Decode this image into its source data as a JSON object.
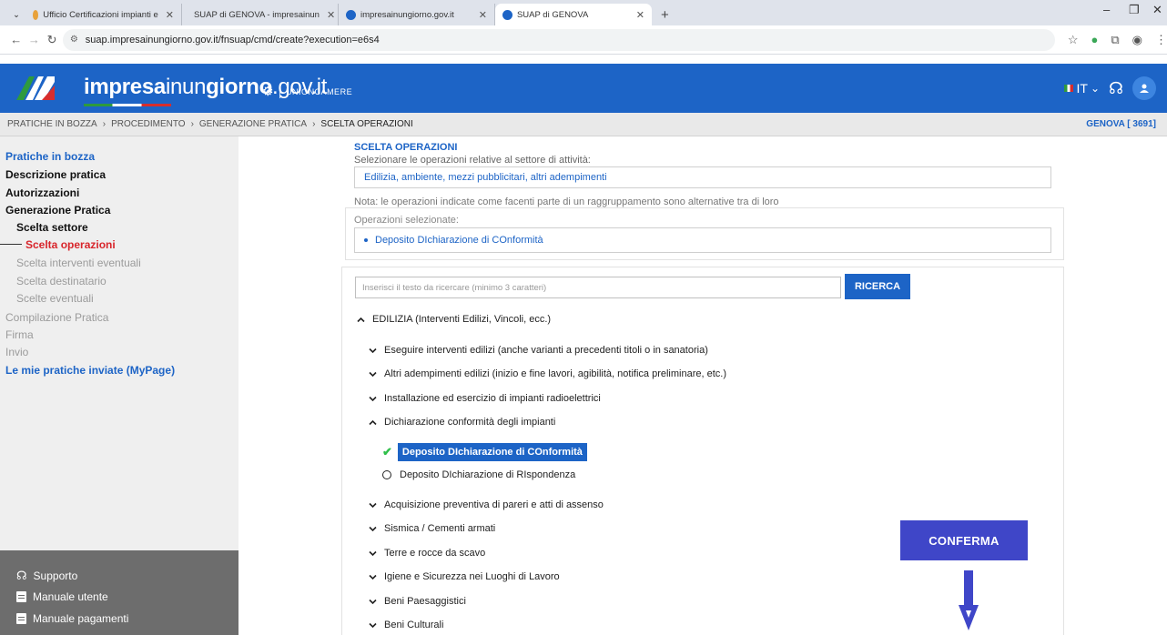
{
  "browser": {
    "tabs": [
      {
        "title": "Ufficio Certificazioni impianti e",
        "active": false
      },
      {
        "title": "SUAP di GENOVA - impresainun",
        "active": false
      },
      {
        "title": "impresainungiorno.gov.it",
        "active": false
      },
      {
        "title": "SUAP di GENOVA",
        "active": true
      }
    ],
    "url": "suap.impresainungiorno.gov.it/fnsuap/cmd/create?execution=e6s4"
  },
  "header": {
    "logo_bold": "impresa",
    "logo_mid": "inun",
    "logo_bold2": "giorno",
    "logo_suffix": ".gov.it",
    "partner": "UNIONCAMERE",
    "language": "IT",
    "brand_color": "#1d64c6"
  },
  "breadcrumb": {
    "items": [
      "PRATICHE IN BOZZA",
      "PROCEDIMENTO",
      "GENERAZIONE PRATICA",
      "SCELTA OPERAZIONI"
    ],
    "location": "GENOVA [ 3691]"
  },
  "sidebar": {
    "items": [
      {
        "label": "Pratiche in bozza",
        "style": "link"
      },
      {
        "label": "Descrizione pratica",
        "style": "black"
      },
      {
        "label": "Autorizzazioni",
        "style": "black"
      },
      {
        "label": "Generazione Pratica",
        "style": "black"
      },
      {
        "label": "Scelta settore",
        "style": "black"
      },
      {
        "label": "Scelta operazioni",
        "style": "current"
      },
      {
        "label": "Scelta interventi eventuali",
        "style": "disabled"
      },
      {
        "label": "Scelta destinatario",
        "style": "disabled"
      },
      {
        "label": "Scelte eventuali",
        "style": "disabled"
      },
      {
        "label": "Compilazione Pratica",
        "style": "disabled"
      },
      {
        "label": "Firma",
        "style": "disabled"
      },
      {
        "label": "Invio",
        "style": "disabled"
      },
      {
        "label": "Le mie pratiche inviate (MyPage)",
        "style": "link"
      }
    ],
    "bottom": [
      {
        "label": "Supporto",
        "icon": "support-icon"
      },
      {
        "label": "Manuale utente",
        "icon": "manual-icon"
      },
      {
        "label": "Manuale pagamenti",
        "icon": "manual-icon"
      }
    ]
  },
  "main": {
    "title": "SCELTA OPERAZIONI",
    "subtitle": "Selezionare le operazioni relative al settore di attività:",
    "sector": "Edilizia, ambiente, mezzi pubblicitari, altri adempimenti",
    "note": "Nota: le operazioni indicate come facenti parte di un raggruppamento sono alternative tra di loro",
    "selected_label": "Operazioni selezionate:",
    "selected_items": [
      "Deposito DIchiarazione di COnformità"
    ],
    "search_placeholder": "Inserisci il testo da ricercare (minimo 3 caratteri)",
    "search_button": "RICERCA",
    "category": "EDILIZIA (Interventi Edilizi, Vincoli, ecc.)",
    "groups": [
      "Eseguire interventi edilizi (anche varianti a precedenti titoli o in sanatoria)",
      "Altri adempimenti edilizi (inizio e fine lavori, agibilità, notifica preliminare, etc.)",
      "Installazione ed esercizio di impianti radioelettrici",
      "Dichiarazione conformità degli impianti",
      "Acquisizione preventiva di pareri e atti di assenso",
      "Sismica / Cementi armati",
      "Terre e rocce da scavo",
      "Igiene e Sicurezza nei Luoghi di Lavoro",
      "Beni Paesaggistici",
      "Beni Culturali"
    ],
    "options": {
      "checked": "Deposito DIchiarazione di COnformità",
      "unchecked": "Deposito DIchiarazione di RIspondenza"
    },
    "confirm_button": "CONFERMA"
  }
}
